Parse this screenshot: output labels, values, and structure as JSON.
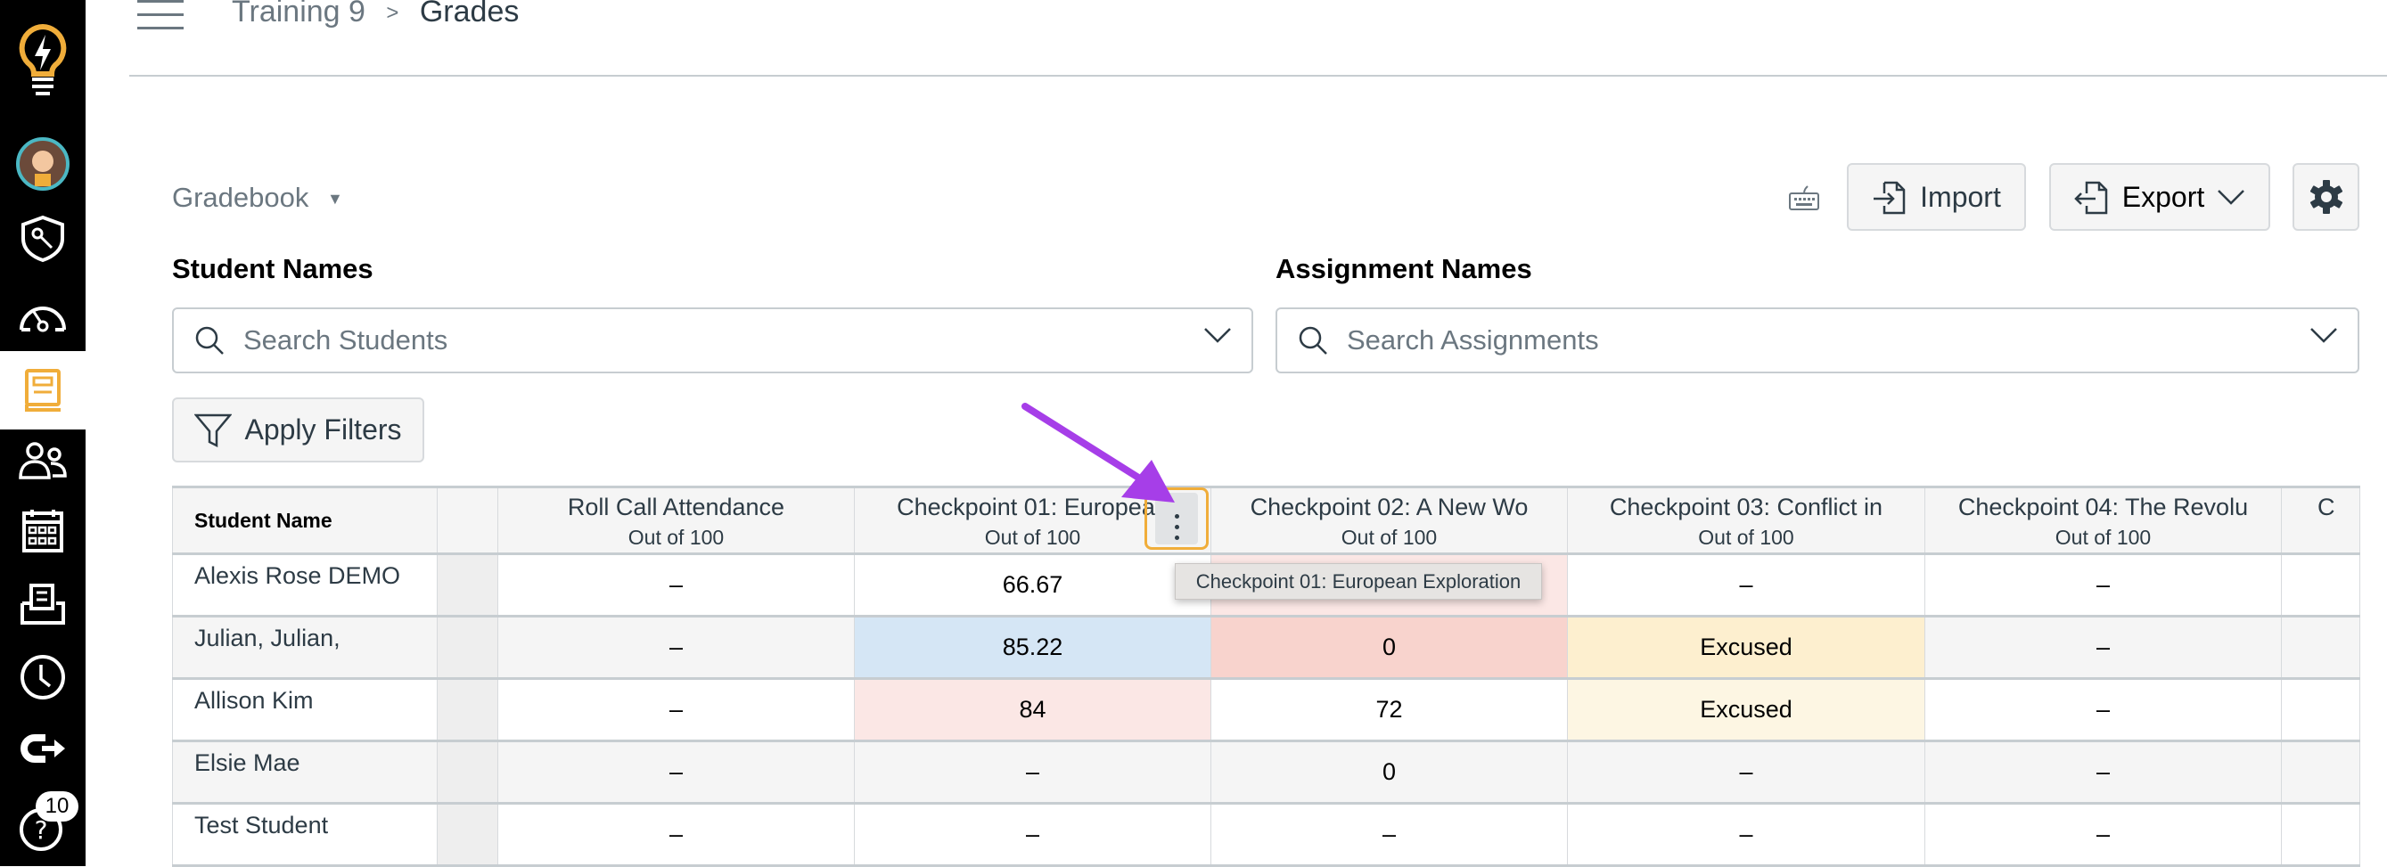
{
  "header": {
    "course": "Training 9",
    "page": "Grades"
  },
  "sidebar": {
    "badge": "10",
    "items": [
      "logo",
      "account",
      "admin",
      "dashboard",
      "courses",
      "groups",
      "calendar",
      "inbox",
      "history",
      "commons",
      "help"
    ],
    "active": "courses",
    "accent": "#f0ad3a"
  },
  "toolbar": {
    "gradebook_label": "Gradebook",
    "import_label": "Import",
    "export_label": "Export"
  },
  "filters": {
    "student_label": "Student Names",
    "student_placeholder": "Search Students",
    "assignment_label": "Assignment Names",
    "assignment_placeholder": "Search Assignments",
    "apply_label": "Apply Filters"
  },
  "table": {
    "student_header": "Student Name",
    "columns": [
      {
        "title": "Roll Call Attendance",
        "sub": "Out of 100"
      },
      {
        "title": "Checkpoint 01: European",
        "sub": "Out of 100"
      },
      {
        "title": "Checkpoint 02: A New Wo",
        "sub": "Out of 100"
      },
      {
        "title": "Checkpoint 03: Conflict in",
        "sub": "Out of 100"
      },
      {
        "title": "Checkpoint 04: The Revolu",
        "sub": "Out of 100"
      },
      {
        "title": "C",
        "sub": ""
      }
    ],
    "rows": [
      {
        "name": "Alexis Rose DEMO",
        "cells": [
          "–",
          "66.67",
          "",
          "–",
          "–",
          ""
        ]
      },
      {
        "name": "Julian, Julian,",
        "cells": [
          "–",
          "85.22",
          "0",
          "Excused",
          "–",
          ""
        ]
      },
      {
        "name": "Allison Kim",
        "cells": [
          "–",
          "84",
          "72",
          "Excused",
          "–",
          ""
        ]
      },
      {
        "name": "Elsie Mae",
        "cells": [
          "–",
          "–",
          "0",
          "–",
          "–",
          ""
        ]
      },
      {
        "name": "Test Student",
        "cells": [
          "–",
          "–",
          "–",
          "–",
          "–",
          ""
        ]
      }
    ],
    "cell_colors": {
      "resubmitted": "#d5e6f5",
      "late": "#fbe7e5",
      "missing": "#f8d3cd",
      "excused": "#fdefcf",
      "dropped": "#fdf6e3"
    }
  },
  "tooltip": "Checkpoint 01: European Exploration",
  "annotation": {
    "arrow_color": "#a63ee8"
  }
}
